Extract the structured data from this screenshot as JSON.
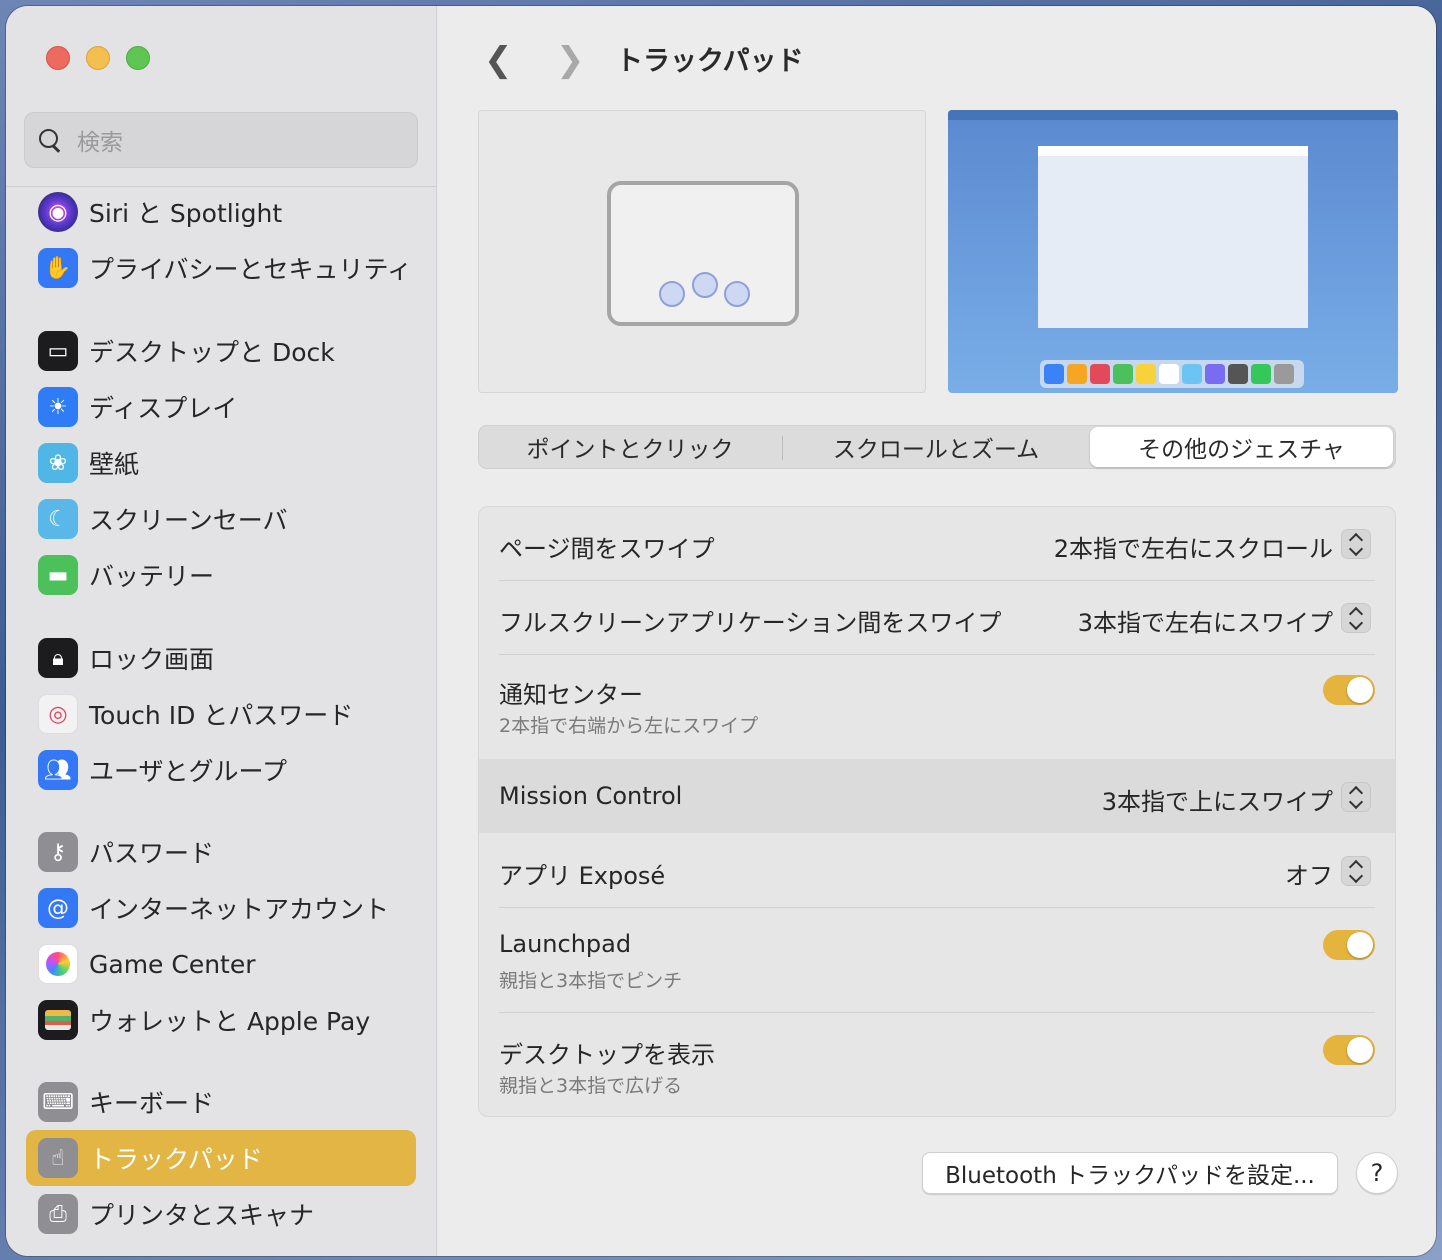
{
  "window": {
    "title": "トラックパッド"
  },
  "sidebar": {
    "search_placeholder": "検索",
    "items": [
      {
        "label": "Siri と Spotlight",
        "icon": "siri-icon",
        "color": "#3a2a6a"
      },
      {
        "label": "プライバシーとセキュリティ",
        "icon": "hand-icon",
        "color": "#3478f6"
      },
      {
        "label": "デスクトップと Dock",
        "icon": "dock-icon",
        "color": "#1c1c1e"
      },
      {
        "label": "ディスプレイ",
        "icon": "brightness-icon",
        "color": "#2f7cf6"
      },
      {
        "label": "壁紙",
        "icon": "flower-icon",
        "color": "#4fb6e6"
      },
      {
        "label": "スクリーンセーバ",
        "icon": "screensaver-icon",
        "color": "#5ab8e8"
      },
      {
        "label": "バッテリー",
        "icon": "battery-icon",
        "color": "#4cc05a"
      },
      {
        "label": "ロック画面",
        "icon": "lock-icon",
        "color": "#1c1c1e"
      },
      {
        "label": "Touch ID とパスワード",
        "icon": "fingerprint-icon",
        "color": "#f2f2f2"
      },
      {
        "label": "ユーザとグループ",
        "icon": "users-icon",
        "color": "#3478f6"
      },
      {
        "label": "パスワード",
        "icon": "key-icon",
        "color": "#8e8e93"
      },
      {
        "label": "インターネットアカウント",
        "icon": "at-icon",
        "color": "#3478f6"
      },
      {
        "label": "Game Center",
        "icon": "game-center-icon",
        "color": "#ffffff"
      },
      {
        "label": "ウォレットと Apple Pay",
        "icon": "wallet-icon",
        "color": "#1c1c1e"
      },
      {
        "label": "キーボード",
        "icon": "keyboard-icon",
        "color": "#8e8e93"
      },
      {
        "label": "トラックパッド",
        "icon": "trackpad-icon",
        "color": "#8e8e93",
        "selected": true
      },
      {
        "label": "プリンタとスキャナ",
        "icon": "printer-icon",
        "color": "#8e8e93"
      }
    ]
  },
  "tabs": [
    {
      "label": "ポイントとクリック"
    },
    {
      "label": "スクロールとズーム"
    },
    {
      "label": "その他のジェスチャ",
      "active": true
    }
  ],
  "settings": [
    {
      "label": "ページ間をスワイプ",
      "value": "2本指で左右にスクロール",
      "control": "stepper"
    },
    {
      "label": "フルスクリーンアプリケーション間をスワイプ",
      "value": "3本指で左右にスワイプ",
      "control": "stepper"
    },
    {
      "label": "通知センター",
      "sub": "2本指で右端から左にスワイプ",
      "control": "toggle",
      "on": true
    },
    {
      "label": "Mission Control",
      "value": "3本指で上にスワイプ",
      "control": "stepper"
    },
    {
      "label": "アプリ Exposé",
      "value": "オフ",
      "control": "stepper"
    },
    {
      "label": "Launchpad",
      "sub": "親指と3本指でピンチ",
      "control": "toggle",
      "on": true
    },
    {
      "label": "デスクトップを表示",
      "sub": "親指と3本指で広げる",
      "control": "toggle",
      "on": true
    }
  ],
  "buttons": {
    "bluetooth": "Bluetooth トラックパッドを設定...",
    "help": "?"
  },
  "colors": {
    "accent": "#e2b544",
    "toggle_on": "#e4b43f"
  }
}
